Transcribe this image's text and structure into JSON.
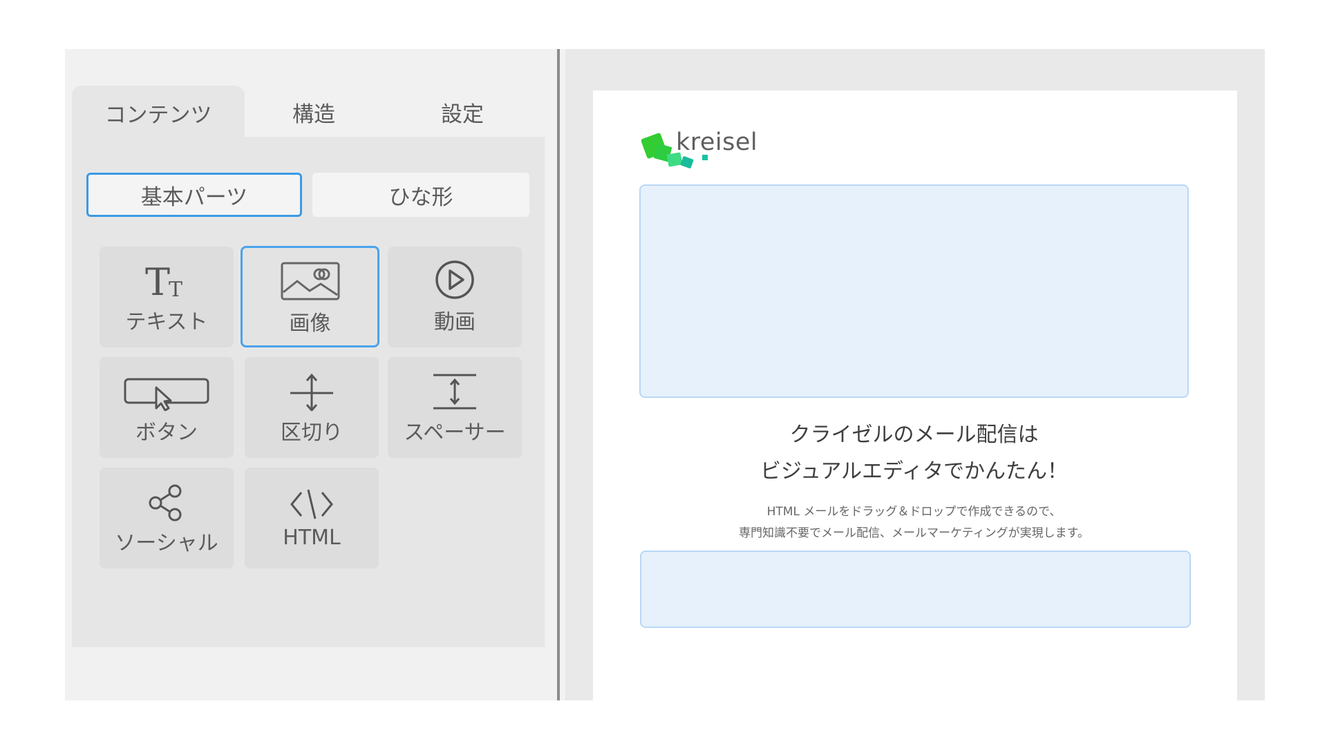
{
  "tabs": [
    {
      "label": "コンテンツ",
      "active": true
    },
    {
      "label": "構造",
      "active": false
    },
    {
      "label": "設定",
      "active": false
    }
  ],
  "segments": [
    {
      "label": "基本パーツ",
      "active": true
    },
    {
      "label": "ひな形",
      "active": false
    }
  ],
  "parts": [
    {
      "label": "テキスト",
      "icon": "text-icon"
    },
    {
      "label": "画像",
      "icon": "image-icon",
      "selected": true
    },
    {
      "label": "動画",
      "icon": "play-icon"
    },
    {
      "label": "ボタン",
      "icon": "button-cursor-icon"
    },
    {
      "label": "区切り",
      "icon": "divider-icon"
    },
    {
      "label": "スペーサー",
      "icon": "spacer-icon"
    },
    {
      "label": "ソーシャル",
      "icon": "share-icon"
    },
    {
      "label": "HTML",
      "icon": "code-icon"
    }
  ],
  "preview": {
    "logo_text": "kreisel",
    "headline_1": "クライゼルのメール配信は",
    "headline_2": "ビジュアルエディタでかんたん！",
    "sub_1": "HTML メールをドラッグ＆ドロップで作成できるので、",
    "sub_2": "専門知識不要でメール配信、メールマーケティングが実現します。"
  },
  "colors": {
    "accent": "#3a9ae6",
    "placeholder_fill": "#e6f1fc",
    "logo_green": "#2ecc40"
  }
}
